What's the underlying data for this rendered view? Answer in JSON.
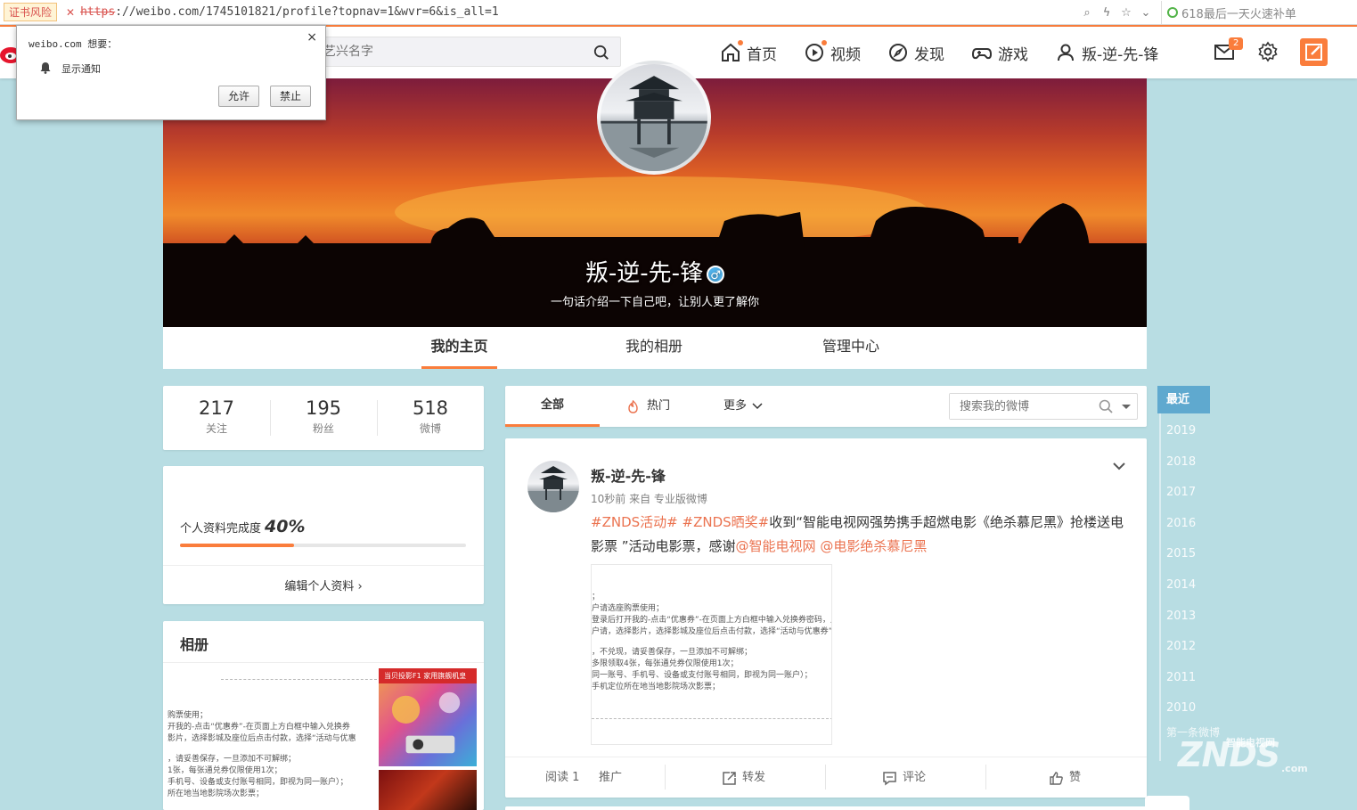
{
  "browser": {
    "cert_warning": "证书风险",
    "url_scheme": "https",
    "url_rest": "://weibo.com/1745101821/profile?topnav=1&wvr=6&is_all=1",
    "search_text": "618最后一天火速补单"
  },
  "notification": {
    "origin": "weibo.com 想要：",
    "permission": "显示通知",
    "allow": "允许",
    "deny": "禁止",
    "close": "×"
  },
  "topnav": {
    "search_placeholder": "艺兴名字",
    "items": [
      {
        "label": "首页",
        "icon": "home-icon",
        "dot": true
      },
      {
        "label": "视频",
        "icon": "video-icon",
        "dot": true
      },
      {
        "label": "发现",
        "icon": "discover-icon",
        "dot": false
      },
      {
        "label": "游戏",
        "icon": "game-icon",
        "dot": false
      },
      {
        "label": "叛-逆-先-锋",
        "icon": "user-icon",
        "dot": false
      }
    ],
    "message_badge": "2"
  },
  "profile": {
    "name": "叛-逆-先-锋",
    "gender_icon": "♂",
    "bio": "一句话介绍一下自己吧，让别人更了解你",
    "tabs": [
      "我的主页",
      "我的相册",
      "管理中心"
    ]
  },
  "stats": [
    {
      "value": "217",
      "label": "关注"
    },
    {
      "value": "195",
      "label": "粉丝"
    },
    {
      "value": "518",
      "label": "微博"
    }
  ],
  "completion": {
    "label": "个人资料完成度",
    "percent_text": "40%",
    "percent": 40,
    "edit": "编辑个人资料"
  },
  "album": {
    "title": "相册",
    "ad_caption": "当贝投影F1 家用旗舰机皇",
    "doc_lines": [
      "购票使用；",
      "开我的-点击“优惠券”-在页面上方白框中输入兑换券",
      "影片，选择影城及座位后点击付款，选择“活动与优惠",
      "，请妥善保存，一旦添加不可解绑；",
      "1张，每张通兑券仅限使用1次；",
      "手机号、设备或支付账号相同，即视为同一账户）；",
      "所在地当地影院场次影票；"
    ]
  },
  "feed_filter": {
    "all": "全部",
    "hot": "热门",
    "more": "更多",
    "search_placeholder": "搜索我的微博"
  },
  "post": {
    "author": "叛-逆-先-锋",
    "time": "10秒前",
    "source": "来自 专业版微博",
    "tag1": "#ZNDS活动#",
    "tag2": "#ZNDS晒奖#",
    "body": "收到“智能电视网强势携手超燃电影《绝杀慕尼黑》抢楼送电影票 ”活动电影票，感谢",
    "mention1": "@智能电视网",
    "mention2": "@电影绝杀慕尼黑",
    "doc_lines": [
      "；",
      "户请选座购票使用；",
      "登录后打开我的-点击“优惠券”-在页面上方白框中输入兑换券密码，点击",
      "户请，选择影片，选择影城及座位后点击付款，选择“活动与优惠券”，选",
      "，不兑现，请妥善保存，一旦添加不可解绑；",
      "多限领取4张，每张通兑券仅限使用1次；",
      "同一账号、手机号、设备或支付账号相同，即视为同一账户）；",
      "手机定位所在地当地影院场次影票；"
    ],
    "reads": "阅读 1",
    "promote": "推广",
    "repost": "转发",
    "comment": "评论",
    "like": "赞"
  },
  "timeline": {
    "recent": "最近",
    "years": [
      "2019",
      "2018",
      "2017",
      "2016",
      "2015",
      "2014",
      "2013",
      "2012",
      "2011",
      "2010"
    ],
    "first": "第一条微博"
  },
  "watermark": {
    "brand": "ZNDS",
    "cn": "智能电视网",
    "com": ".com"
  }
}
